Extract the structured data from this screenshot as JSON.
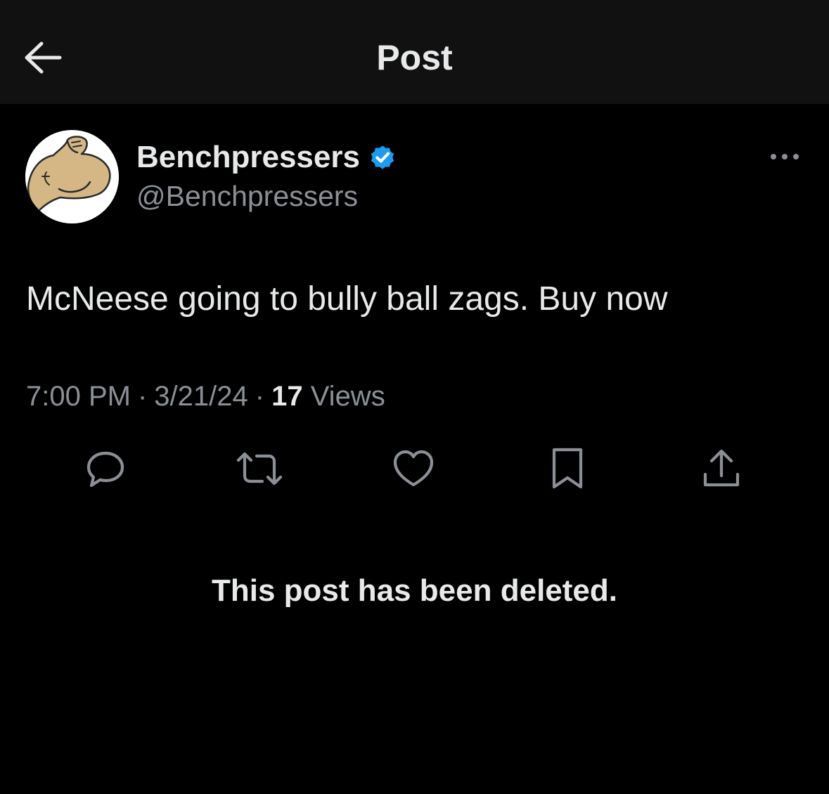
{
  "header": {
    "title": "Post",
    "back_icon": "arrow-left-icon"
  },
  "author": {
    "display_name": "Benchpressers",
    "handle": "@Benchpressers",
    "verified": true,
    "verified_color": "#1d9bf0",
    "avatar_icon": "flexed-bicep-icon"
  },
  "post": {
    "text": "McNeese going to bully ball zags. Buy now",
    "time": "7:00 PM",
    "date": "3/21/24",
    "separator": "·",
    "views_count": "17",
    "views_label": "Views"
  },
  "actions": [
    {
      "name": "reply",
      "icon": "reply-icon"
    },
    {
      "name": "repost",
      "icon": "repost-icon"
    },
    {
      "name": "like",
      "icon": "heart-icon"
    },
    {
      "name": "bookmark",
      "icon": "bookmark-icon"
    },
    {
      "name": "share",
      "icon": "share-icon"
    }
  ],
  "status_message": "This post has been deleted.",
  "colors": {
    "background": "#000000",
    "header_background": "#111111",
    "text_primary": "#e7e9ea",
    "text_secondary": "#8b9096",
    "icon": "#8b9096"
  }
}
